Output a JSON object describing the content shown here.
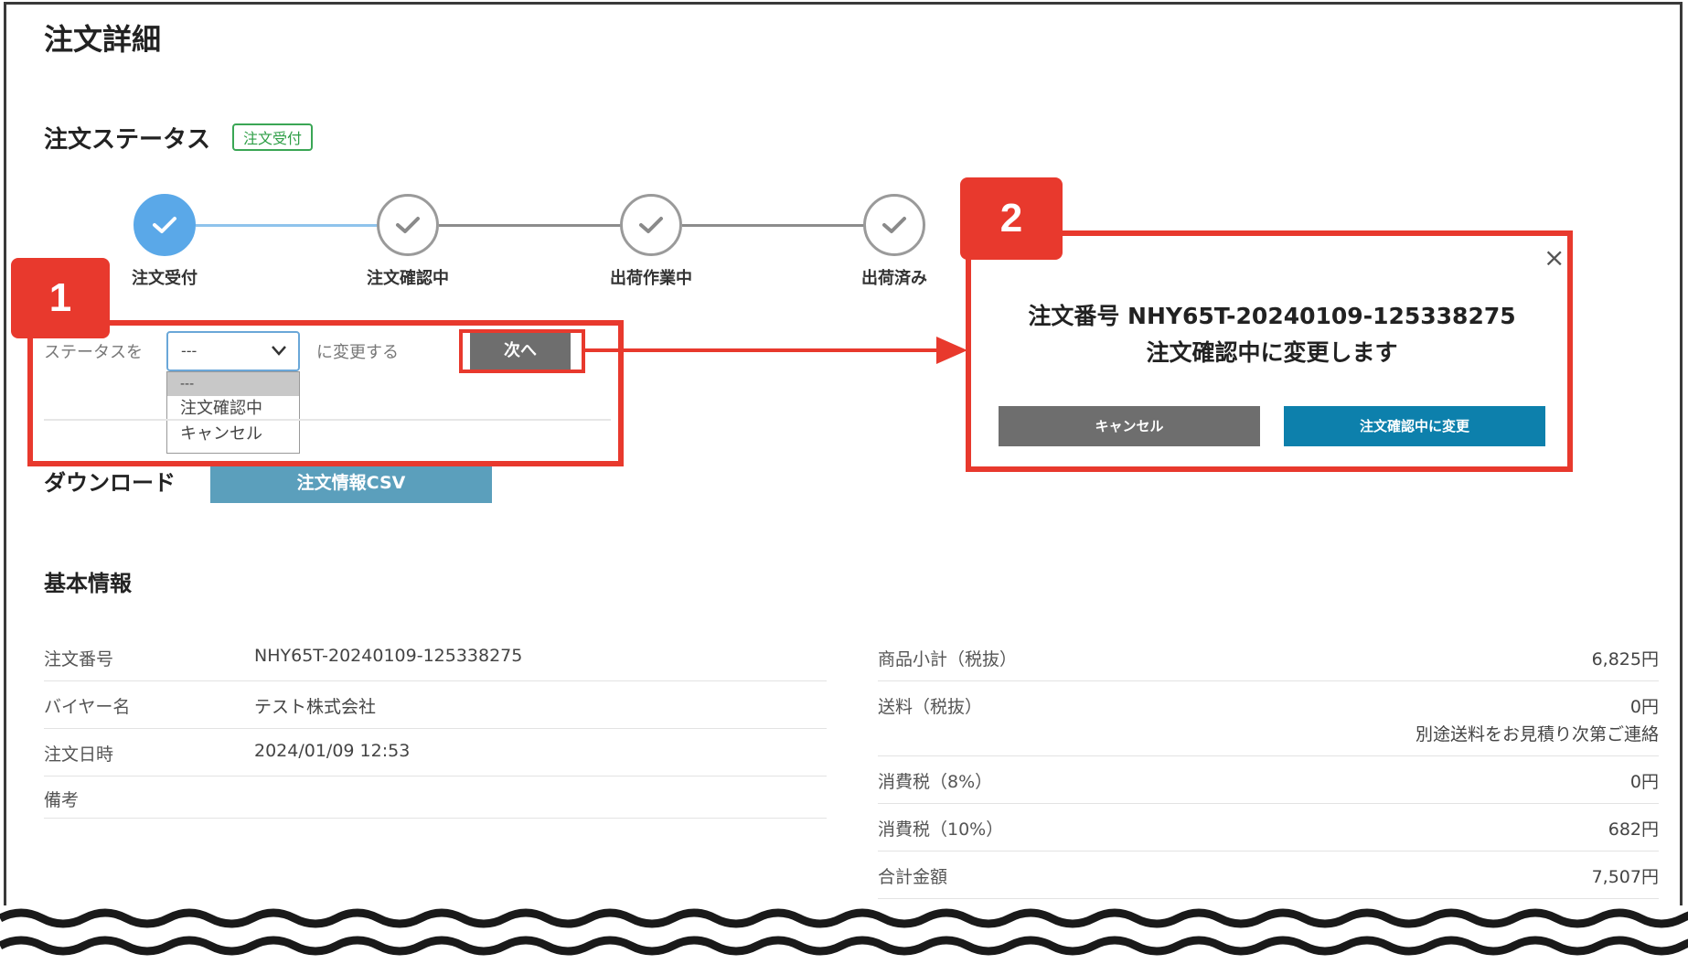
{
  "page": {
    "title": "注文詳細"
  },
  "order_status": {
    "heading": "注文ステータス",
    "badge": "注文受付",
    "steps": [
      {
        "label": "注文受付",
        "state": "current"
      },
      {
        "label": "注文確認中",
        "state": "pending"
      },
      {
        "label": "出荷作業中",
        "state": "pending"
      },
      {
        "label": "出荷済み",
        "state": "pending"
      }
    ]
  },
  "status_change": {
    "prefix": "ステータスを",
    "select_value": "---",
    "options": [
      "---",
      "注文確認中",
      "キャンセル"
    ],
    "suffix": "に変更する",
    "next_button": "次へ"
  },
  "download": {
    "heading": "ダウンロード",
    "csv_button": "注文情報CSV"
  },
  "modal": {
    "line1": "注文番号 NHY65T-20240109-125338275",
    "line2": "注文確認中に変更します",
    "close": "×",
    "cancel_button": "キャンセル",
    "confirm_button": "注文確認中に変更"
  },
  "annotations": {
    "tag1": "1",
    "tag2": "2"
  },
  "basic_info": {
    "heading": "基本情報",
    "left": [
      {
        "label": "注文番号",
        "value": "NHY65T-20240109-125338275"
      },
      {
        "label": "バイヤー名",
        "value": "テスト株式会社"
      },
      {
        "label": "注文日時",
        "value": "2024/01/09 12:53"
      },
      {
        "label": "備考",
        "value": ""
      }
    ],
    "right": [
      {
        "label": "商品小計（税抜）",
        "value": "6,825円",
        "note": ""
      },
      {
        "label": "送料（税抜）",
        "value": "0円",
        "note": "別途送料をお見積り次第ご連絡"
      },
      {
        "label": "消費税（8%）",
        "value": "0円",
        "note": ""
      },
      {
        "label": "消費税（10%）",
        "value": "682円",
        "note": ""
      },
      {
        "label": "合計金額",
        "value": "7,507円",
        "note": ""
      }
    ]
  },
  "colors": {
    "accent_red": "#e8392d",
    "step_active": "#5aa8e8",
    "confirm_blue": "#0d80ac",
    "csv_button": "#5b9fbc",
    "badge_green": "#3aa655"
  }
}
